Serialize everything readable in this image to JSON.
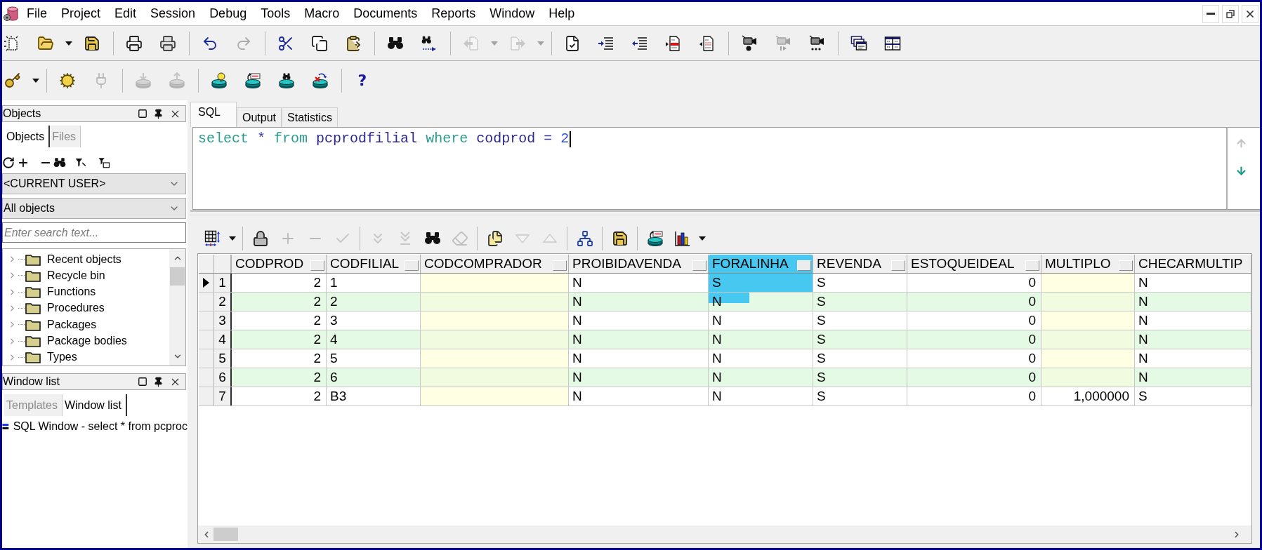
{
  "menu_bar": {
    "items": [
      "File",
      "Project",
      "Edit",
      "Session",
      "Debug",
      "Tools",
      "Macro",
      "Documents",
      "Reports",
      "Window",
      "Help"
    ]
  },
  "main_toolbar": {
    "groups": [
      [
        {
          "disabled": false
        },
        {
          "disabled": false
        },
        {
          "disabled": false
        }
      ],
      [
        {
          "disabled": false
        },
        {
          "disabled": false
        }
      ],
      [
        {
          "disabled": false
        },
        {
          "disabled": true
        }
      ],
      [
        {
          "disabled": false
        },
        {
          "disabled": false
        },
        {
          "disabled": false
        }
      ],
      [
        {
          "disabled": false
        },
        {
          "disabled": false
        }
      ],
      [
        {
          "disabled": true
        },
        {
          "disabled": true
        }
      ],
      [
        {
          "disabled": false
        },
        {
          "disabled": false
        },
        {
          "disabled": false
        },
        {
          "disabled": false
        },
        {
          "disabled": false
        }
      ],
      [
        {
          "disabled": false
        },
        {
          "disabled": true
        },
        {
          "disabled": false
        }
      ],
      [
        {
          "disabled": false
        },
        {
          "disabled": false
        }
      ]
    ]
  },
  "session_toolbar": {
    "groups": [
      [
        {
          "disabled": false
        }
      ],
      [
        {
          "disabled": false
        },
        {
          "disabled": true
        }
      ],
      [
        {
          "disabled": true
        },
        {
          "disabled": true
        }
      ],
      [
        {
          "disabled": false
        },
        {
          "disabled": false
        },
        {
          "disabled": false
        },
        {
          "disabled": false
        }
      ],
      [
        {
          "disabled": false,
          "label": "?"
        }
      ]
    ]
  },
  "objects_panel": {
    "title": "Objects",
    "tabs": [
      {
        "label": "Objects",
        "selected": true
      },
      {
        "label": "Files",
        "selected": false
      }
    ],
    "owner_filter": "<CURRENT USER>",
    "type_filter": "All objects",
    "search": {
      "placeholder": "Enter search text..."
    },
    "tree": [
      {
        "label": "Recent objects",
        "expanded": false
      },
      {
        "label": "Recycle bin",
        "expanded": false
      },
      {
        "label": "Functions",
        "expanded": false
      },
      {
        "label": "Procedures",
        "expanded": false
      },
      {
        "label": "Packages",
        "expanded": false
      },
      {
        "label": "Package bodies",
        "expanded": false
      },
      {
        "label": "Types",
        "expanded": false
      }
    ]
  },
  "window_list_panel": {
    "title": "Window list",
    "tabs": [
      {
        "label": "Templates",
        "selected": false
      },
      {
        "label": "Window list",
        "selected": true
      }
    ],
    "windows": [
      {
        "label": "SQL Window - select * from pcproc"
      }
    ]
  },
  "editor_tabs": [
    {
      "label": "SQL",
      "selected": true
    },
    {
      "label": "Output",
      "selected": false
    },
    {
      "label": "Statistics",
      "selected": false
    }
  ],
  "sql_editor": {
    "focused": true,
    "tokens": [
      {
        "text": "select",
        "kind": "keyword"
      },
      {
        "text": "*",
        "kind": "operator"
      },
      {
        "text": "from",
        "kind": "keyword"
      },
      {
        "text": "pcprodfilial",
        "kind": "identifier"
      },
      {
        "text": "where",
        "kind": "keyword"
      },
      {
        "text": "codprod",
        "kind": "identifier"
      },
      {
        "text": "=",
        "kind": "operator"
      },
      {
        "text": "2",
        "kind": "number"
      }
    ]
  },
  "editor_nav": [
    {
      "disabled": true
    },
    {
      "disabled": false
    }
  ],
  "result_toolbar": {
    "groups": [
      [
        {
          "disabled": false
        }
      ],
      [
        {
          "disabled": false
        },
        {
          "disabled": true
        },
        {
          "disabled": true
        },
        {
          "disabled": true
        }
      ],
      [
        {
          "disabled": true
        },
        {
          "disabled": true
        },
        {
          "disabled": false
        },
        {
          "disabled": true
        }
      ],
      [
        {
          "disabled": false
        },
        {
          "disabled": true
        },
        {
          "disabled": true
        }
      ],
      [
        {
          "disabled": false
        }
      ],
      [
        {
          "disabled": false
        }
      ],
      [
        {
          "disabled": false
        },
        {
          "disabled": false
        }
      ]
    ]
  },
  "result_grid": {
    "columns": [
      {
        "name": "CODPROD",
        "kind": "number",
        "highlighted": false,
        "clipped": false
      },
      {
        "name": "CODFILIAL",
        "kind": "text",
        "highlighted": false,
        "clipped": false
      },
      {
        "name": "CODCOMPRADOR",
        "kind": "number",
        "highlighted": false,
        "clipped": false
      },
      {
        "name": "PROIBIDAVENDA",
        "kind": "text",
        "highlighted": false,
        "clipped": false
      },
      {
        "name": "FORALINHA",
        "kind": "text",
        "highlighted": true,
        "clipped": false
      },
      {
        "name": "REVENDA",
        "kind": "text",
        "highlighted": false,
        "clipped": false
      },
      {
        "name": "ESTOQUEIDEAL",
        "kind": "number",
        "highlighted": false,
        "clipped": false
      },
      {
        "name": "MULTIPLO",
        "kind": "number",
        "highlighted": false,
        "clipped": false
      },
      {
        "name": "CHECARMULTIP",
        "kind": "text",
        "highlighted": false,
        "clipped": true
      }
    ],
    "rows": [
      {
        "number": "1",
        "selected": true,
        "cells": [
          "2",
          "1",
          null,
          "N",
          "S",
          "S",
          "0",
          null,
          "N"
        ]
      },
      {
        "number": "2",
        "selected": false,
        "cells": [
          "2",
          "2",
          null,
          "N",
          "N",
          "S",
          "0",
          null,
          "N"
        ]
      },
      {
        "number": "3",
        "selected": false,
        "cells": [
          "2",
          "3",
          null,
          "N",
          "N",
          "S",
          "0",
          null,
          "N"
        ]
      },
      {
        "number": "4",
        "selected": false,
        "cells": [
          "2",
          "4",
          null,
          "N",
          "N",
          "S",
          "0",
          null,
          "N"
        ]
      },
      {
        "number": "5",
        "selected": false,
        "cells": [
          "2",
          "5",
          null,
          "N",
          "N",
          "S",
          "0",
          null,
          "N"
        ]
      },
      {
        "number": "6",
        "selected": false,
        "cells": [
          "2",
          "6",
          null,
          "N",
          "N",
          "S",
          "0",
          null,
          "N"
        ]
      },
      {
        "number": "7",
        "selected": false,
        "cells": [
          "2",
          "B3",
          null,
          "N",
          "N",
          "S",
          "0",
          "1,000000",
          "S"
        ]
      }
    ]
  }
}
